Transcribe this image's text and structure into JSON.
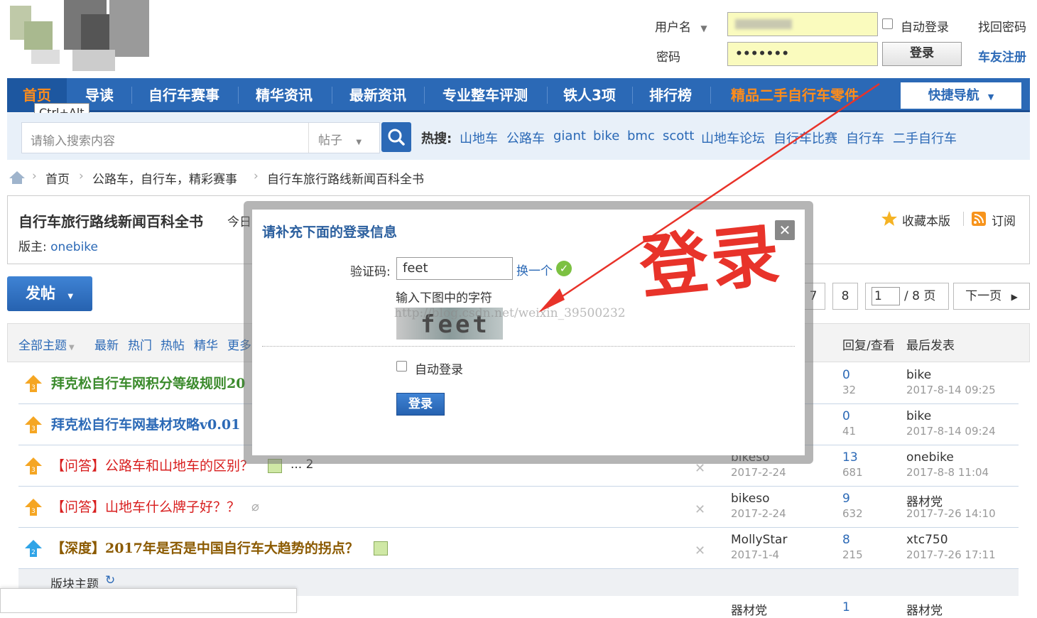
{
  "header": {
    "username_label": "用户名",
    "password_label": "密码",
    "password_value": "•••••••",
    "auto_login": "自动登录",
    "recover_password": "找回密码",
    "login_button": "登录",
    "register": "车友注册"
  },
  "nav": {
    "items": [
      "首页",
      "导读",
      "自行车赛事",
      "精华资讯",
      "最新资讯",
      "专业整车评测",
      "铁人3项",
      "排行榜",
      "精品二手自行车零件"
    ],
    "quick_nav": "快捷导航",
    "tooltip": "Ctrl+Alt"
  },
  "search": {
    "placeholder": "请输入搜索内容",
    "type": "帖子",
    "hot_label": "热搜:",
    "hot_terms": [
      "山地车",
      "公路车",
      "giant",
      "bike",
      "bmc",
      "scott",
      "山地车论坛",
      "自行车比赛",
      "自行车",
      "二手自行车"
    ]
  },
  "breadcrumb": [
    "首页",
    "公路车，自行车，精彩赛事",
    "自行车旅行路线新闻百科全书"
  ],
  "forum": {
    "title": "自行车旅行路线新闻百科全书",
    "today_prefix": "今日",
    "moderator_label": "版主:",
    "moderator": "onebike",
    "favorite": "收藏本版",
    "subscribe": "订阅",
    "post_button": "发帖"
  },
  "pagination": {
    "pages": [
      "7",
      "8"
    ],
    "current": "1",
    "total": "/ 8 页",
    "next": "下一页"
  },
  "thread_header": {
    "filters": [
      "全部主题",
      "最新",
      "热门",
      "热帖",
      "精华",
      "更多"
    ],
    "reply_view": "回复/查看",
    "last_post": "最后发表"
  },
  "threads": [
    {
      "title": "拜克松自行车网积分等级规则20",
      "author": "",
      "date": "",
      "replies": "0",
      "views": "32",
      "last_user": "bike",
      "last_time": "2017-8-14 09:25",
      "color": "#3a8a2b"
    },
    {
      "title": "拜克松自行车网基材攻略v0.01",
      "author": "",
      "date": "",
      "replies": "0",
      "views": "41",
      "last_user": "bike",
      "last_time": "2017-8-14 09:24",
      "color": "#2b69b6"
    },
    {
      "title": "【问答】公路车和山地车的区别？",
      "extra": "... 2",
      "author": "bikeso",
      "date": "2017-2-24",
      "replies": "13",
      "views": "681",
      "last_user": "onebike",
      "last_time": "2017-8-8 11:04",
      "color": "#d81e1e"
    },
    {
      "title": "【问答】山地车什么牌子好？？",
      "author": "bikeso",
      "date": "2017-2-24",
      "replies": "9",
      "views": "632",
      "last_user": "器材党",
      "last_time": "2017-7-26 14:10",
      "color": "#d81e1e"
    },
    {
      "title": "【深度】2017年是否是中国自行车大趋势的拐点？",
      "author": "MollyStar",
      "date": "2017-1-4",
      "replies": "8",
      "views": "215",
      "last_user": "xtc750",
      "last_time": "2017-7-26 17:11",
      "color": "#8b5a00"
    }
  ],
  "section_label": "版块主题",
  "bottom_row": {
    "author": "器材党",
    "replies": "1",
    "last_user": "器材党"
  },
  "modal": {
    "title": "请补充下面的登录信息",
    "captcha_label": "验证码:",
    "captcha_value": "feet",
    "refresh": "换一个",
    "hint": "输入下图中的字符",
    "captcha_image_text": "feet",
    "watermark": "http://blog.csdn.net/weixin_39500232",
    "auto_login": "自动登录",
    "login_button": "登录"
  },
  "annotation": {
    "text": "登录",
    "color": "#e8332a"
  }
}
